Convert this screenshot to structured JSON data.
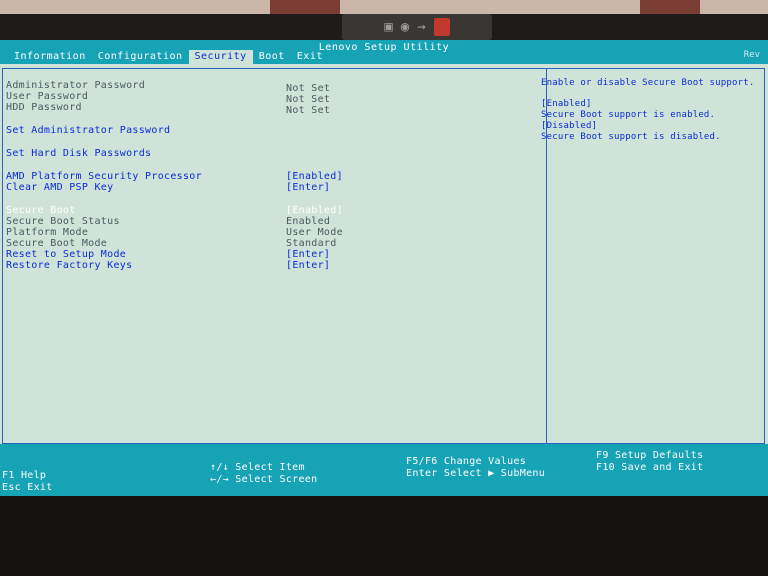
{
  "app": {
    "title": "Lenovo Setup Utility"
  },
  "camera": {
    "icon_left": "camera-off-icon",
    "icon_right": "camera-icon"
  },
  "tabs": [
    {
      "label": "Information"
    },
    {
      "label": "Configuration"
    },
    {
      "label": "Security",
      "active": true
    },
    {
      "label": "Boot"
    },
    {
      "label": "Exit"
    }
  ],
  "top_right_hint": "Rev",
  "security": {
    "admin_password": {
      "label": "Administrator Password",
      "value": "Not Set"
    },
    "user_password": {
      "label": "User Password",
      "value": "Not Set"
    },
    "hdd_password": {
      "label": "HDD Password",
      "value": "Not Set"
    },
    "set_admin_password": {
      "label": "Set Administrator Password"
    },
    "set_hdd_passwords": {
      "label": "Set Hard Disk Passwords"
    },
    "amd_psp": {
      "label": "AMD Platform Security Processor",
      "value": "[Enabled]"
    },
    "clear_psp_key": {
      "label": "Clear AMD PSP Key",
      "value": "[Enter]"
    },
    "secure_boot": {
      "label": "Secure Boot",
      "value": "[Enabled]"
    },
    "secure_boot_status": {
      "label": "Secure Boot Status",
      "value": "Enabled"
    },
    "platform_mode": {
      "label": "Platform Mode",
      "value": "User Mode"
    },
    "secure_boot_mode": {
      "label": "Secure Boot Mode",
      "value": "Standard"
    },
    "reset_setup_mode": {
      "label": "Reset to Setup Mode",
      "value": "[Enter]"
    },
    "restore_factory_keys": {
      "label": "Restore Factory Keys",
      "value": "[Enter]"
    }
  },
  "help": {
    "line1": "Enable or disable Secure Boot support.",
    "line2": "[Enabled]",
    "line3": "Secure Boot support is enabled.",
    "line4": "[Disabled]",
    "line5": "Secure Boot support is disabled."
  },
  "footer": {
    "f1": "F1  Help",
    "esc": "Esc Exit",
    "select_item": "↑/↓ Select Item",
    "select_screen": "←/→ Select Screen",
    "change_values": "F5/F6 Change Values",
    "select_submenu": "Enter Select ▶ SubMenu",
    "f9": "F9  Setup Defaults",
    "f10": "F10 Save and Exit"
  },
  "colors": {
    "screen_bg": "#cfe3d8",
    "bar_teal": "#17a3b6",
    "link_blue": "#0b2bd6",
    "static_gray": "#4a5a60",
    "selected_white": "#ffffff"
  }
}
